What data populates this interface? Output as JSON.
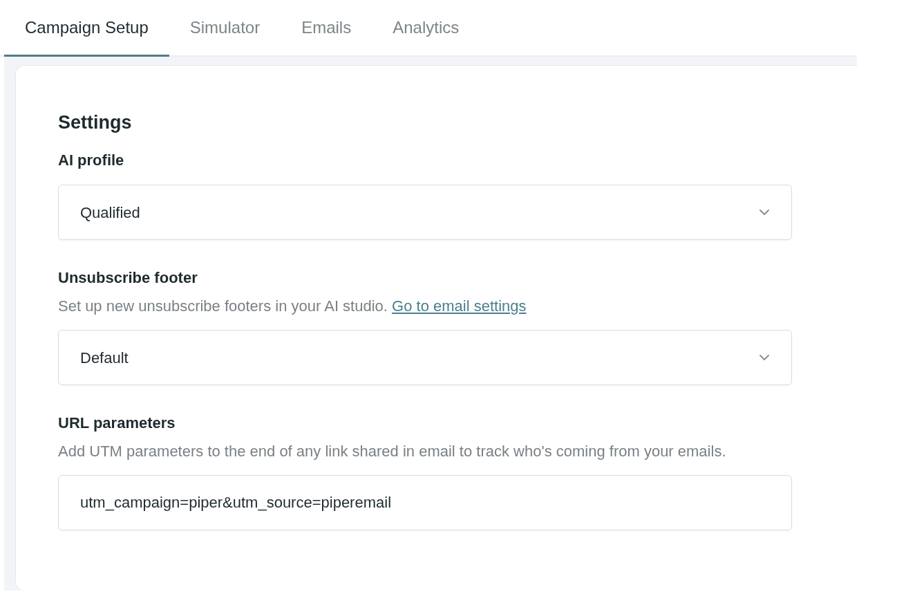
{
  "tabs": [
    {
      "label": "Campaign Setup",
      "selected": true
    },
    {
      "label": "Simulator",
      "selected": false
    },
    {
      "label": "Emails",
      "selected": false
    },
    {
      "label": "Analytics",
      "selected": false
    }
  ],
  "settings": {
    "title": "Settings",
    "fields": [
      {
        "kind": "select",
        "label": "AI profile",
        "value": "Qualified"
      },
      {
        "kind": "select",
        "label": "Unsubscribe footer",
        "description": "Set up new unsubscribe footers in your AI studio.",
        "link": "Go to email settings",
        "value": "Default"
      },
      {
        "kind": "text",
        "label": "URL parameters",
        "description": "Add UTM parameters to the end of any link shared in email to track who's coming from your emails.",
        "value": "utm_campaign=piper&utm_source=piperemail"
      }
    ]
  }
}
